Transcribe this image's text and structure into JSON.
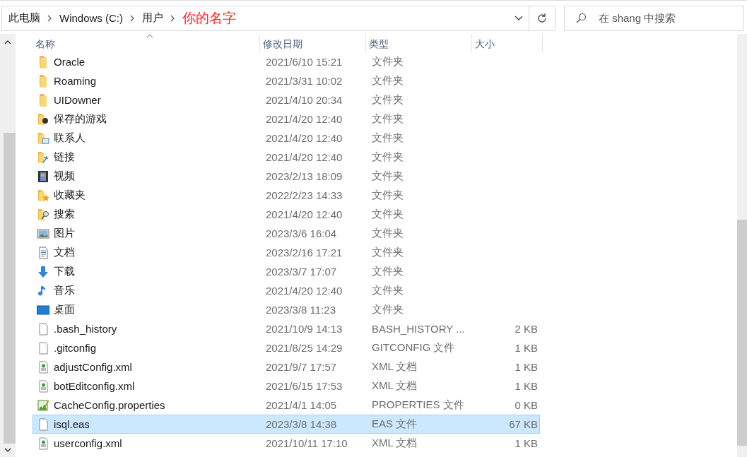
{
  "address_bar": {
    "crumbs": [
      {
        "label": "此电脑",
        "kind": "normal"
      },
      {
        "label": "Windows (C:)",
        "kind": "normal"
      },
      {
        "label": "用户",
        "kind": "normal"
      },
      {
        "label": "你的名字",
        "kind": "annotation"
      }
    ]
  },
  "search": {
    "placeholder": "在 shang 中搜索"
  },
  "columns": [
    {
      "label": "名称",
      "sorted": true
    },
    {
      "label": "修改日期",
      "sorted": false
    },
    {
      "label": "类型",
      "sorted": false
    },
    {
      "label": "大小",
      "sorted": false
    }
  ],
  "rows": [
    {
      "name": "Oracle",
      "date": "2021/6/10 15:21",
      "type": "文件夹",
      "kind": "folder",
      "selected": false
    },
    {
      "name": "Roaming",
      "date": "2021/3/31 10:02",
      "type": "文件夹",
      "kind": "folder",
      "selected": false
    },
    {
      "name": "UIDowner",
      "date": "2021/4/10 20:34",
      "type": "文件夹",
      "kind": "folder",
      "selected": false
    },
    {
      "name": "保存的游戏",
      "date": "2021/4/20 12:40",
      "type": "文件夹",
      "kind": "folder-game",
      "selected": false
    },
    {
      "name": "联系人",
      "date": "2021/4/20 12:40",
      "type": "文件夹",
      "kind": "folder-contacts",
      "selected": false
    },
    {
      "name": "链接",
      "date": "2021/4/20 12:40",
      "type": "文件夹",
      "kind": "folder-link",
      "selected": false
    },
    {
      "name": "视频",
      "date": "2023/2/13 18:09",
      "type": "文件夹",
      "kind": "video",
      "selected": false
    },
    {
      "name": "收藏夹",
      "date": "2022/2/23 14:33",
      "type": "文件夹",
      "kind": "folder-star",
      "selected": false
    },
    {
      "name": "搜索",
      "date": "2021/4/20 12:40",
      "type": "文件夹",
      "kind": "folder-search",
      "selected": false
    },
    {
      "name": "图片",
      "date": "2023/3/6 16:04",
      "type": "文件夹",
      "kind": "picture",
      "selected": false
    },
    {
      "name": "文档",
      "date": "2023/2/16 17:21",
      "type": "文件夹",
      "kind": "document",
      "selected": false
    },
    {
      "name": "下载",
      "date": "2023/3/7 17:07",
      "type": "文件夹",
      "kind": "download",
      "selected": false
    },
    {
      "name": "音乐",
      "date": "2021/4/20 12:40",
      "type": "文件夹",
      "kind": "music",
      "selected": false
    },
    {
      "name": "桌面",
      "date": "2023/3/8 11:23",
      "type": "文件夹",
      "kind": "desktop",
      "selected": false
    },
    {
      "name": ".bash_history",
      "date": "2021/10/9 14:13",
      "type": "BASH_HISTORY ...",
      "size": "2 KB",
      "kind": "file",
      "selected": false
    },
    {
      "name": ".gitconfig",
      "date": "2021/8/25 14:29",
      "type": "GITCONFIG 文件",
      "size": "1 KB",
      "kind": "file",
      "selected": false
    },
    {
      "name": "adjustConfig.xml",
      "date": "2021/9/7 17:57",
      "type": "XML 文档",
      "size": "1 KB",
      "kind": "xml",
      "selected": false
    },
    {
      "name": "botEditconfig.xml",
      "date": "2021/6/15 17:53",
      "type": "XML 文档",
      "size": "1 KB",
      "kind": "xml",
      "selected": false
    },
    {
      "name": "CacheConfig.properties",
      "date": "2021/4/1 14:05",
      "type": "PROPERTIES 文件",
      "size": "0 KB",
      "kind": "properties",
      "selected": false
    },
    {
      "name": "isql.eas",
      "date": "2023/3/8 14:38",
      "type": "EAS 文件",
      "size": "67 KB",
      "kind": "file",
      "selected": true
    },
    {
      "name": "userconfig.xml",
      "date": "2021/10/11 17:10",
      "type": "XML 文档",
      "size": "1 KB",
      "kind": "xml",
      "selected": false
    }
  ]
}
